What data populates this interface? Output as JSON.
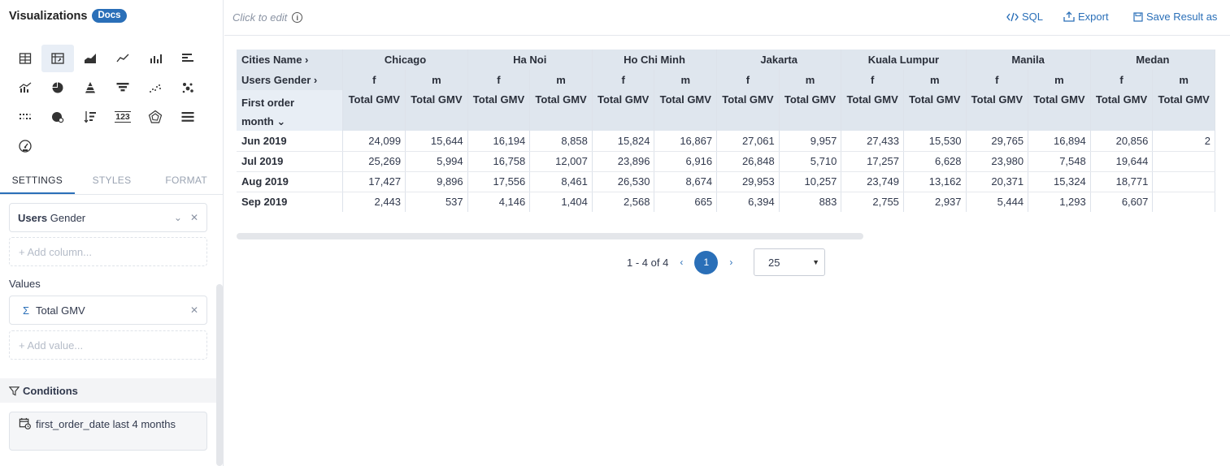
{
  "left": {
    "title": "Visualizations",
    "docs_badge": "Docs",
    "viz_icons": [
      "table-icon",
      "pivot-table-icon",
      "area-chart-icon",
      "line-chart-icon",
      "bar-chart-icon",
      "horizontal-bar-icon",
      "combo-chart-icon",
      "pie-chart-icon",
      "pyramid-icon",
      "funnel-icon",
      "scatter-icon",
      "bubble-icon",
      "heatmap-icon",
      "map-icon",
      "sorted-bar-icon",
      "number-icon",
      "radar-icon",
      "bullet-icon",
      "gauge-icon"
    ],
    "number_icon_text": "123",
    "tabs": [
      "SETTINGS",
      "STYLES",
      "FORMAT"
    ],
    "column_pill": {
      "bold": "Users",
      "rest": "Gender"
    },
    "add_column": "+ Add column...",
    "values_label": "Values",
    "value_pill": "Total GMV",
    "add_value": "+ Add value...",
    "conditions_label": "Conditions",
    "condition_text": "first_order_date last 4 months"
  },
  "toolbar": {
    "click_to_edit": "Click to edit",
    "sql": "SQL",
    "export": "Export",
    "save": "Save Result as"
  },
  "pivot": {
    "col_header_label": "Cities Name",
    "gender_header_label": "Users Gender",
    "row_header_label_line1": "First order",
    "row_header_label_line2": "month",
    "measure": "Total GMV",
    "cities": [
      "Chicago",
      "Ha Noi",
      "Ho Chi Minh",
      "Jakarta",
      "Kuala Lumpur",
      "Manila",
      "Medan"
    ],
    "genders": [
      "f",
      "m"
    ],
    "rows": [
      {
        "label": "Jun 2019",
        "values": [
          "24,099",
          "15,644",
          "16,194",
          "8,858",
          "15,824",
          "16,867",
          "27,061",
          "9,957",
          "27,433",
          "15,530",
          "29,765",
          "16,894",
          "20,856",
          "2"
        ]
      },
      {
        "label": "Jul 2019",
        "values": [
          "25,269",
          "5,994",
          "16,758",
          "12,007",
          "23,896",
          "6,916",
          "26,848",
          "5,710",
          "17,257",
          "6,628",
          "23,980",
          "7,548",
          "19,644",
          ""
        ]
      },
      {
        "label": "Aug 2019",
        "values": [
          "17,427",
          "9,896",
          "17,556",
          "8,461",
          "26,530",
          "8,674",
          "29,953",
          "10,257",
          "23,749",
          "13,162",
          "20,371",
          "15,324",
          "18,771",
          ""
        ]
      },
      {
        "label": "Sep 2019",
        "values": [
          "2,443",
          "537",
          "4,146",
          "1,404",
          "2,568",
          "665",
          "6,394",
          "883",
          "2,755",
          "2,937",
          "5,444",
          "1,293",
          "6,607",
          ""
        ]
      }
    ]
  },
  "pager": {
    "range": "1 - 4 of 4",
    "prev": "‹",
    "current": "1",
    "next": "›",
    "page_size": "25"
  }
}
